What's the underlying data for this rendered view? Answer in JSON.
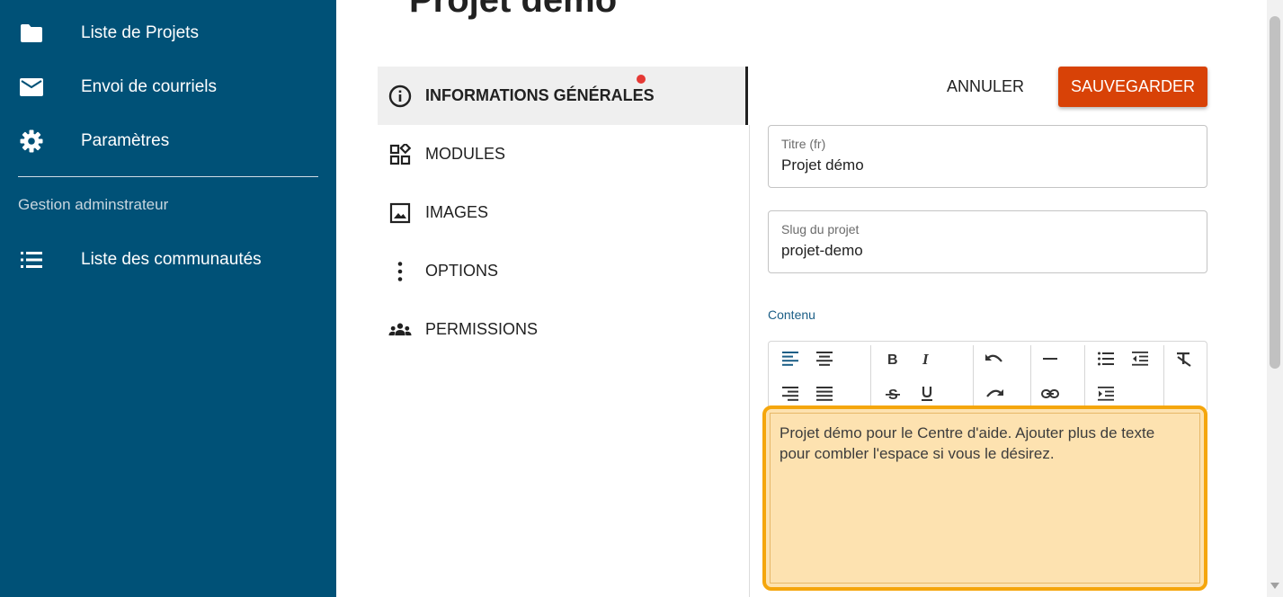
{
  "sidebar": {
    "items": [
      {
        "label": "Liste de Projets",
        "icon": "folder-icon"
      },
      {
        "label": "Envoi de courriels",
        "icon": "mail-icon"
      },
      {
        "label": "Paramètres",
        "icon": "gear-icon"
      }
    ],
    "section_label": "Gestion adminstrateur",
    "admin_items": [
      {
        "label": "Liste des communautés",
        "icon": "list-icon"
      }
    ]
  },
  "page": {
    "title": "Projet démo"
  },
  "tabs": [
    {
      "label": "INFORMATIONS GÉNÉRALES",
      "icon": "info-icon",
      "active": true,
      "has_notification": true
    },
    {
      "label": "MODULES",
      "icon": "widgets-icon"
    },
    {
      "label": "IMAGES",
      "icon": "image-icon"
    },
    {
      "label": "OPTIONS",
      "icon": "more-vertical-icon"
    },
    {
      "label": "PERMISSIONS",
      "icon": "group-icon"
    }
  ],
  "actions": {
    "cancel_label": "ANNULER",
    "save_label": "SAUVEGARDER"
  },
  "form": {
    "title_field": {
      "label": "Titre (fr)",
      "value": "Projet démo"
    },
    "slug_field": {
      "label": "Slug du projet",
      "value": "projet-demo"
    },
    "content_label": "Contenu",
    "content_text": "Projet démo pour le Centre d'aide. Ajouter plus de texte pour combler l'espace si vous le désirez."
  },
  "toolbar": {
    "buttons": [
      "align-left-icon",
      "align-center-icon",
      "align-right-icon",
      "align-justify-icon",
      "bold-icon",
      "italic-icon",
      "strikethrough-icon",
      "underline-icon",
      "undo-icon",
      "redo-icon",
      "horizontal-rule-icon",
      "link-icon",
      "bullet-list-icon",
      "outdent-icon",
      "indent-icon",
      "clear-format-icon"
    ]
  },
  "colors": {
    "sidebar_bg": "#005177",
    "save_button": "#d84207",
    "highlight_border": "#f5a60c",
    "highlight_fill": "#fde2b0",
    "notification": "#e53935"
  }
}
